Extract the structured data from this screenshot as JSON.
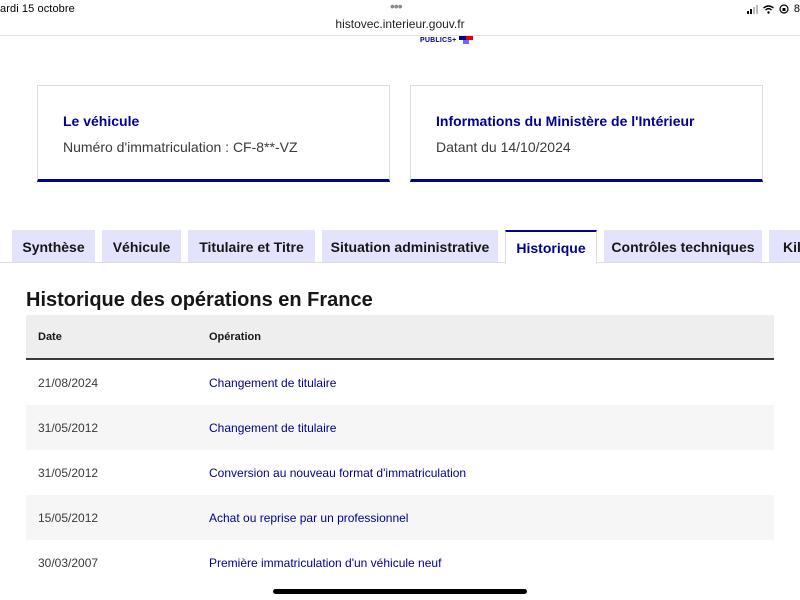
{
  "status_bar": {
    "date": "ardi 15 octobre",
    "dots": "•••",
    "url": "histovec.interieur.gouv.fr",
    "battery_fragment": "8"
  },
  "logo": {
    "text": "PUBLICS+"
  },
  "vehicle_card": {
    "title": "Le véhicule",
    "plate_line": "Numéro d'immatriculation : CF-8**-VZ"
  },
  "ministry_card": {
    "title": "Informations du Ministère de l'Intérieur",
    "date_line": "Datant du 14/10/2024"
  },
  "tabs": [
    {
      "label": "Synthèse",
      "active": false
    },
    {
      "label": "Véhicule",
      "active": false
    },
    {
      "label": "Titulaire et Titre",
      "active": false
    },
    {
      "label": "Situation administrative",
      "active": false
    },
    {
      "label": "Historique",
      "active": true
    },
    {
      "label": "Contrôles techniques",
      "active": false
    },
    {
      "label": "Kilo",
      "active": false
    }
  ],
  "history": {
    "title": "Historique des opérations en France",
    "columns": {
      "date": "Date",
      "operation": "Opération"
    },
    "rows": [
      {
        "date": "21/08/2024",
        "operation": "Changement de titulaire"
      },
      {
        "date": "31/05/2012",
        "operation": "Changement de titulaire"
      },
      {
        "date": "31/05/2012",
        "operation": "Conversion au nouveau format d'immatriculation"
      },
      {
        "date": "15/05/2012",
        "operation": "Achat ou reprise par un professionnel"
      },
      {
        "date": "30/03/2007",
        "operation": "Première immatriculation d'un véhicule neuf"
      }
    ]
  },
  "colors": {
    "brand_blue": "#000091",
    "tab_inactive_bg": "#e3e3fd",
    "table_header_bg": "#eeeeee",
    "row_alt_bg": "#f6f6f6"
  }
}
